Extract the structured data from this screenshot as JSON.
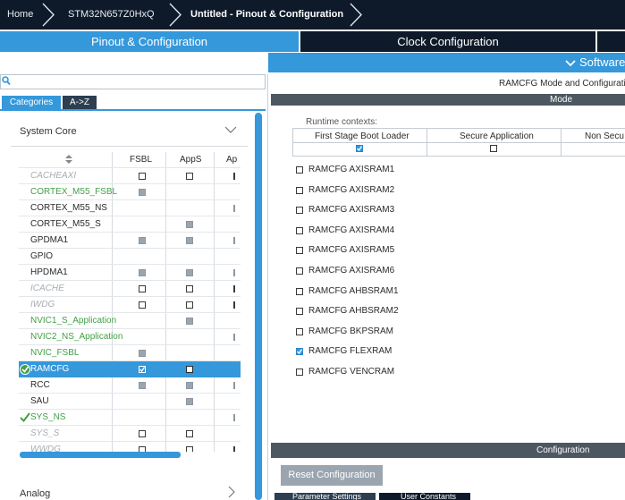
{
  "breadcrumbs": {
    "home": "Home",
    "device": "STM32N657Z0HxQ",
    "project": "Untitled - Pinout & Configuration"
  },
  "main_tabs": {
    "pinout": "Pinout & Configuration",
    "clock": "Clock Configuration"
  },
  "software_packs": {
    "label": "Software"
  },
  "search": {
    "value": "",
    "placeholder": ""
  },
  "category_tabs": {
    "categories": "Categories",
    "az": "A->Z"
  },
  "system_core": {
    "label": "System Core",
    "table": {
      "columns": [
        "FSBL",
        "AppS",
        "Ap"
      ],
      "rows": [
        {
          "name": "CACHEAXI",
          "style": "gray",
          "fsbl": "empty",
          "apps": "empty",
          "ap": "trunc"
        },
        {
          "name": "CORTEX_M55_FSBL",
          "style": "green",
          "fsbl": "checked",
          "apps": "none",
          "ap": "none"
        },
        {
          "name": "CORTEX_M55_NS",
          "style": "normal",
          "fsbl": "none",
          "apps": "none",
          "ap": "trunc-light"
        },
        {
          "name": "CORTEX_M55_S",
          "style": "normal",
          "fsbl": "none",
          "apps": "checked",
          "ap": "none"
        },
        {
          "name": "GPDMA1",
          "style": "normal",
          "fsbl": "checked",
          "apps": "checked",
          "ap": "trunc-light"
        },
        {
          "name": "GPIO",
          "style": "normal",
          "fsbl": "none",
          "apps": "none",
          "ap": "none"
        },
        {
          "name": "HPDMA1",
          "style": "normal",
          "fsbl": "checked",
          "apps": "checked",
          "ap": "trunc-light"
        },
        {
          "name": "ICACHE",
          "style": "gray",
          "fsbl": "empty",
          "apps": "empty",
          "ap": "trunc"
        },
        {
          "name": "IWDG",
          "style": "gray",
          "fsbl": "empty",
          "apps": "empty",
          "ap": "trunc"
        },
        {
          "name": "NVIC1_S_Application",
          "style": "green",
          "fsbl": "none",
          "apps": "checked",
          "ap": "none"
        },
        {
          "name": "NVIC2_NS_Application",
          "style": "green",
          "fsbl": "none",
          "apps": "none",
          "ap": "trunc-light"
        },
        {
          "name": "NVIC_FSBL",
          "style": "green",
          "fsbl": "checked",
          "apps": "none",
          "ap": "none"
        },
        {
          "name": "RAMCFG",
          "style": "selected",
          "fsbl": "sel-checked",
          "apps": "sel-empty",
          "ap": "none",
          "check": true
        },
        {
          "name": "RCC",
          "style": "normal",
          "fsbl": "checked",
          "apps": "checked",
          "ap": "trunc-light"
        },
        {
          "name": "SAU",
          "style": "normal",
          "fsbl": "none",
          "apps": "checked",
          "ap": "none"
        },
        {
          "name": "SYS_NS",
          "style": "green",
          "fsbl": "none",
          "apps": "none",
          "ap": "trunc-light",
          "check": true
        },
        {
          "name": "SYS_S",
          "style": "gray",
          "fsbl": "empty",
          "apps": "empty",
          "ap": "none"
        },
        {
          "name": "WWDG",
          "style": "gray",
          "fsbl": "empty",
          "apps": "empty",
          "ap": "trunc"
        }
      ]
    }
  },
  "analog": {
    "label": "Analog"
  },
  "mode_panel": {
    "title": "RAMCFG Mode and Configuratio",
    "mode_header": "Mode",
    "runtime_label": "Runtime contexts:",
    "contexts": [
      {
        "name": "First Stage Boot Loader",
        "checked": true
      },
      {
        "name": "Secure Application",
        "checked": false
      },
      {
        "name": "Non Secu",
        "checked": false
      }
    ],
    "ram_items": [
      {
        "label": "RAMCFG AXISRAM1",
        "checked": false
      },
      {
        "label": "RAMCFG AXISRAM2",
        "checked": false
      },
      {
        "label": "RAMCFG AXISRAM3",
        "checked": false
      },
      {
        "label": "RAMCFG AXISRAM4",
        "checked": false
      },
      {
        "label": "RAMCFG AXISRAM5",
        "checked": false
      },
      {
        "label": "RAMCFG AXISRAM6",
        "checked": false
      },
      {
        "label": "RAMCFG AHBSRAM1",
        "checked": false
      },
      {
        "label": "RAMCFG AHBSRAM2",
        "checked": false
      },
      {
        "label": "RAMCFG BKPSRAM",
        "checked": false
      },
      {
        "label": "RAMCFG FLEXRAM",
        "checked": true
      },
      {
        "label": "RAMCFG VENCRAM",
        "checked": false
      }
    ]
  },
  "configuration": {
    "header": "Configuration",
    "reset_button": "Reset Configuration",
    "tabs": [
      "Parameter Settings",
      "User Constants"
    ]
  },
  "colors": {
    "accent": "#3498db",
    "dark_nav": "#0e1a2a",
    "green_text": "#43a047",
    "disabled_text": "#a7adb3"
  }
}
